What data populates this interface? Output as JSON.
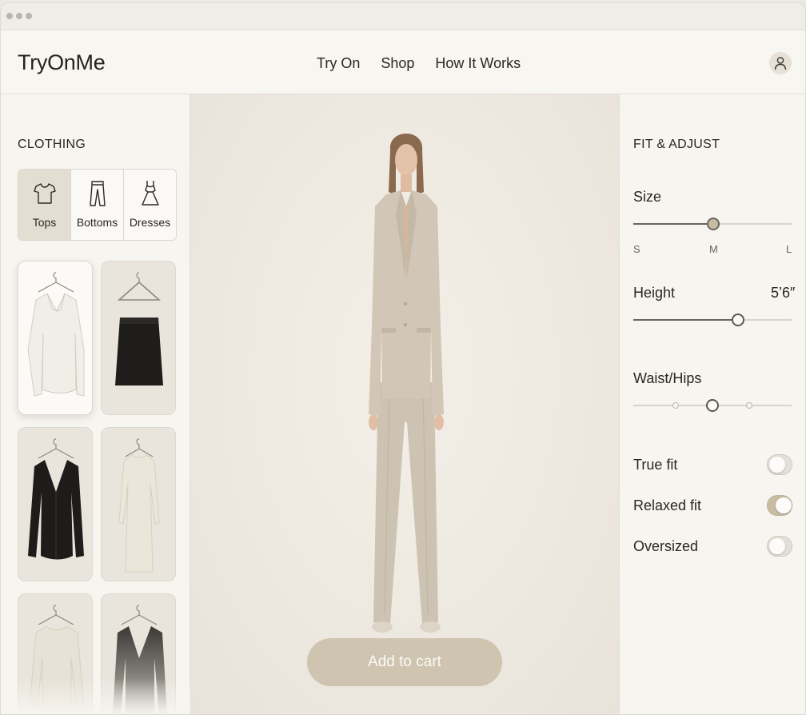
{
  "app": {
    "logo": "TryOnMe"
  },
  "nav": {
    "links": [
      "Try On",
      "Shop",
      "How It Works"
    ]
  },
  "clothing": {
    "title": "CLOTHING",
    "tabs": [
      {
        "label": "Tops",
        "icon": "tshirt-icon",
        "active": true
      },
      {
        "label": "Bottoms",
        "icon": "pants-icon",
        "active": false
      },
      {
        "label": "Dresses",
        "icon": "dress-icon",
        "active": false
      }
    ],
    "items": [
      {
        "name": "white-blouse",
        "selected": true
      },
      {
        "name": "black-skirt",
        "selected": false
      },
      {
        "name": "black-cardigan",
        "selected": false
      },
      {
        "name": "cream-knit-dress",
        "selected": false
      },
      {
        "name": "cream-sweater",
        "selected": false
      },
      {
        "name": "gray-blazer",
        "selected": false
      }
    ]
  },
  "preview": {
    "cart_label": "Add to cart"
  },
  "fit": {
    "title": "FIT & ADJUST",
    "size": {
      "label": "Size",
      "ticks": [
        "S",
        "M",
        "L"
      ],
      "value": "M"
    },
    "height": {
      "label": "Height",
      "value": "5’6″",
      "fraction": 0.66
    },
    "waist": {
      "label": "Waist/Hips",
      "fraction": 0.5
    },
    "toggles": [
      {
        "label": "True fit",
        "on": false
      },
      {
        "label": "Relaxed fit",
        "on": true
      },
      {
        "label": "Oversized",
        "on": false
      }
    ]
  },
  "colors": {
    "accent": "#c9bca3",
    "button": "#cfc4b0",
    "background": "#f7f5f0"
  }
}
